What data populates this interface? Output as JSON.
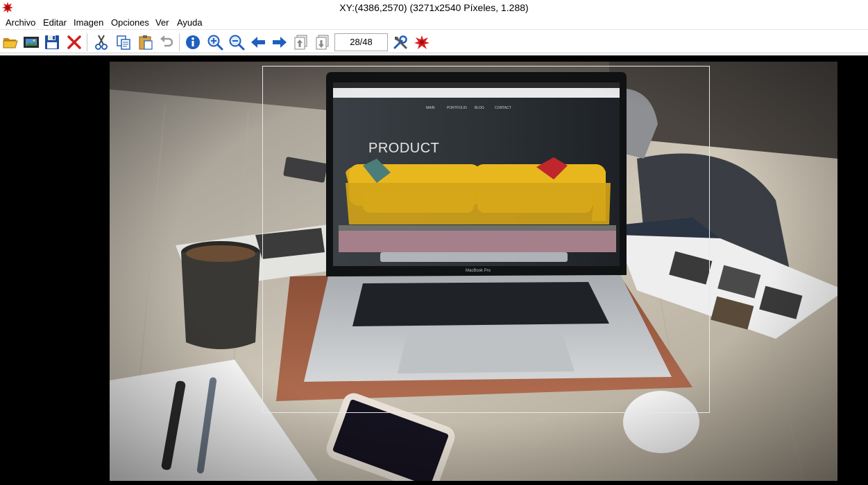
{
  "window": {
    "title": "XY:(4386,2570)  (3271x2540 Píxeles, 1.288)"
  },
  "menu": {
    "items": [
      "Archivo",
      "Editar",
      "Imagen",
      "Opciones",
      "Ver",
      "Ayuda"
    ]
  },
  "toolbar": {
    "page_indicator": "28/48"
  },
  "photo": {
    "screen_heading": "PRODUCT",
    "nav_items": [
      "MAIN",
      "PORTFOLIO",
      "BLOG",
      "CONTACT"
    ],
    "laptop_label": "MacBook Pro"
  },
  "colors": {
    "viewer_background": "#000000",
    "sofa": "#e8b71e",
    "app_icon": "#d81f1f"
  }
}
